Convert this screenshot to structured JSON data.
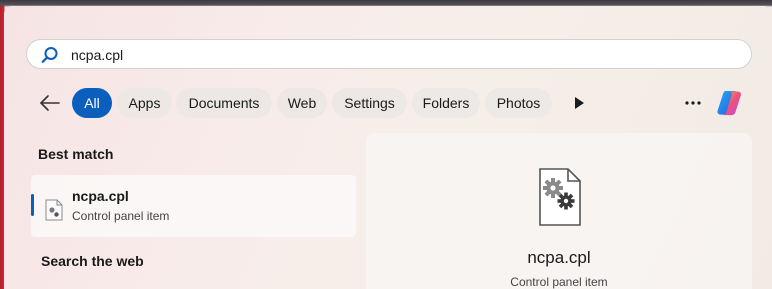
{
  "search": {
    "query": "ncpa.cpl",
    "placeholder": ""
  },
  "filters": [
    {
      "label": "All",
      "active": true
    },
    {
      "label": "Apps"
    },
    {
      "label": "Documents"
    },
    {
      "label": "Web"
    },
    {
      "label": "Settings"
    },
    {
      "label": "Folders"
    },
    {
      "label": "Photos"
    }
  ],
  "icons": {
    "search": "search-icon",
    "back": "back-arrow-icon",
    "play": "play-icon",
    "more": "more-options-icon",
    "copilot": "copilot-icon",
    "file": "control-panel-file-icon"
  },
  "sections": {
    "best_match": "Best match",
    "search_web": "Search the web"
  },
  "best_match": {
    "title": "ncpa.cpl",
    "subtitle": "Control panel item"
  },
  "preview": {
    "title": "ncpa.cpl",
    "subtitle": "Control panel item"
  },
  "colors": {
    "accent": "#0a5fbd",
    "wallpaper_red": "#c52a36"
  }
}
